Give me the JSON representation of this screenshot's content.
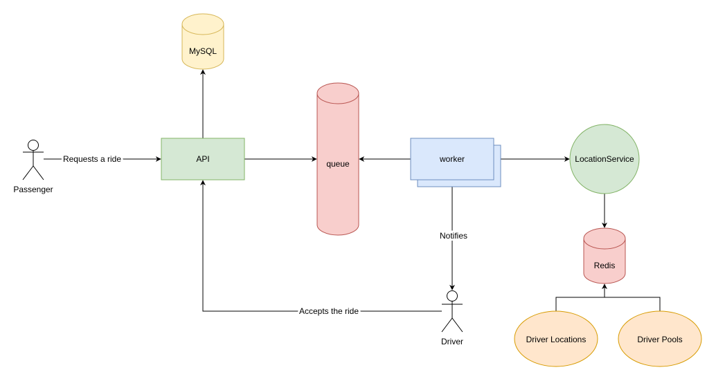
{
  "nodes": {
    "passenger": "Passenger",
    "api": "API",
    "mysql": "MySQL",
    "queue": "queue",
    "worker": "worker",
    "location_service": "LocationService",
    "redis": "Redis",
    "driver": "Driver",
    "driver_locations": "Driver Locations",
    "driver_pools": "Driver Pools"
  },
  "edges": {
    "requests": "Requests a ride",
    "notifies": "Notifies",
    "accepts": "Accepts the ride"
  },
  "colors": {
    "green_fill": "#d5e8d4",
    "green_stroke": "#82b366",
    "yellow_fill": "#fff2cc",
    "yellow_stroke": "#d6b656",
    "red_fill": "#f8cecc",
    "red_stroke": "#b85450",
    "blue_fill": "#dae8fc",
    "blue_stroke": "#6c8ebf",
    "orange_fill": "#ffe6cc",
    "orange_stroke": "#d79b00"
  }
}
